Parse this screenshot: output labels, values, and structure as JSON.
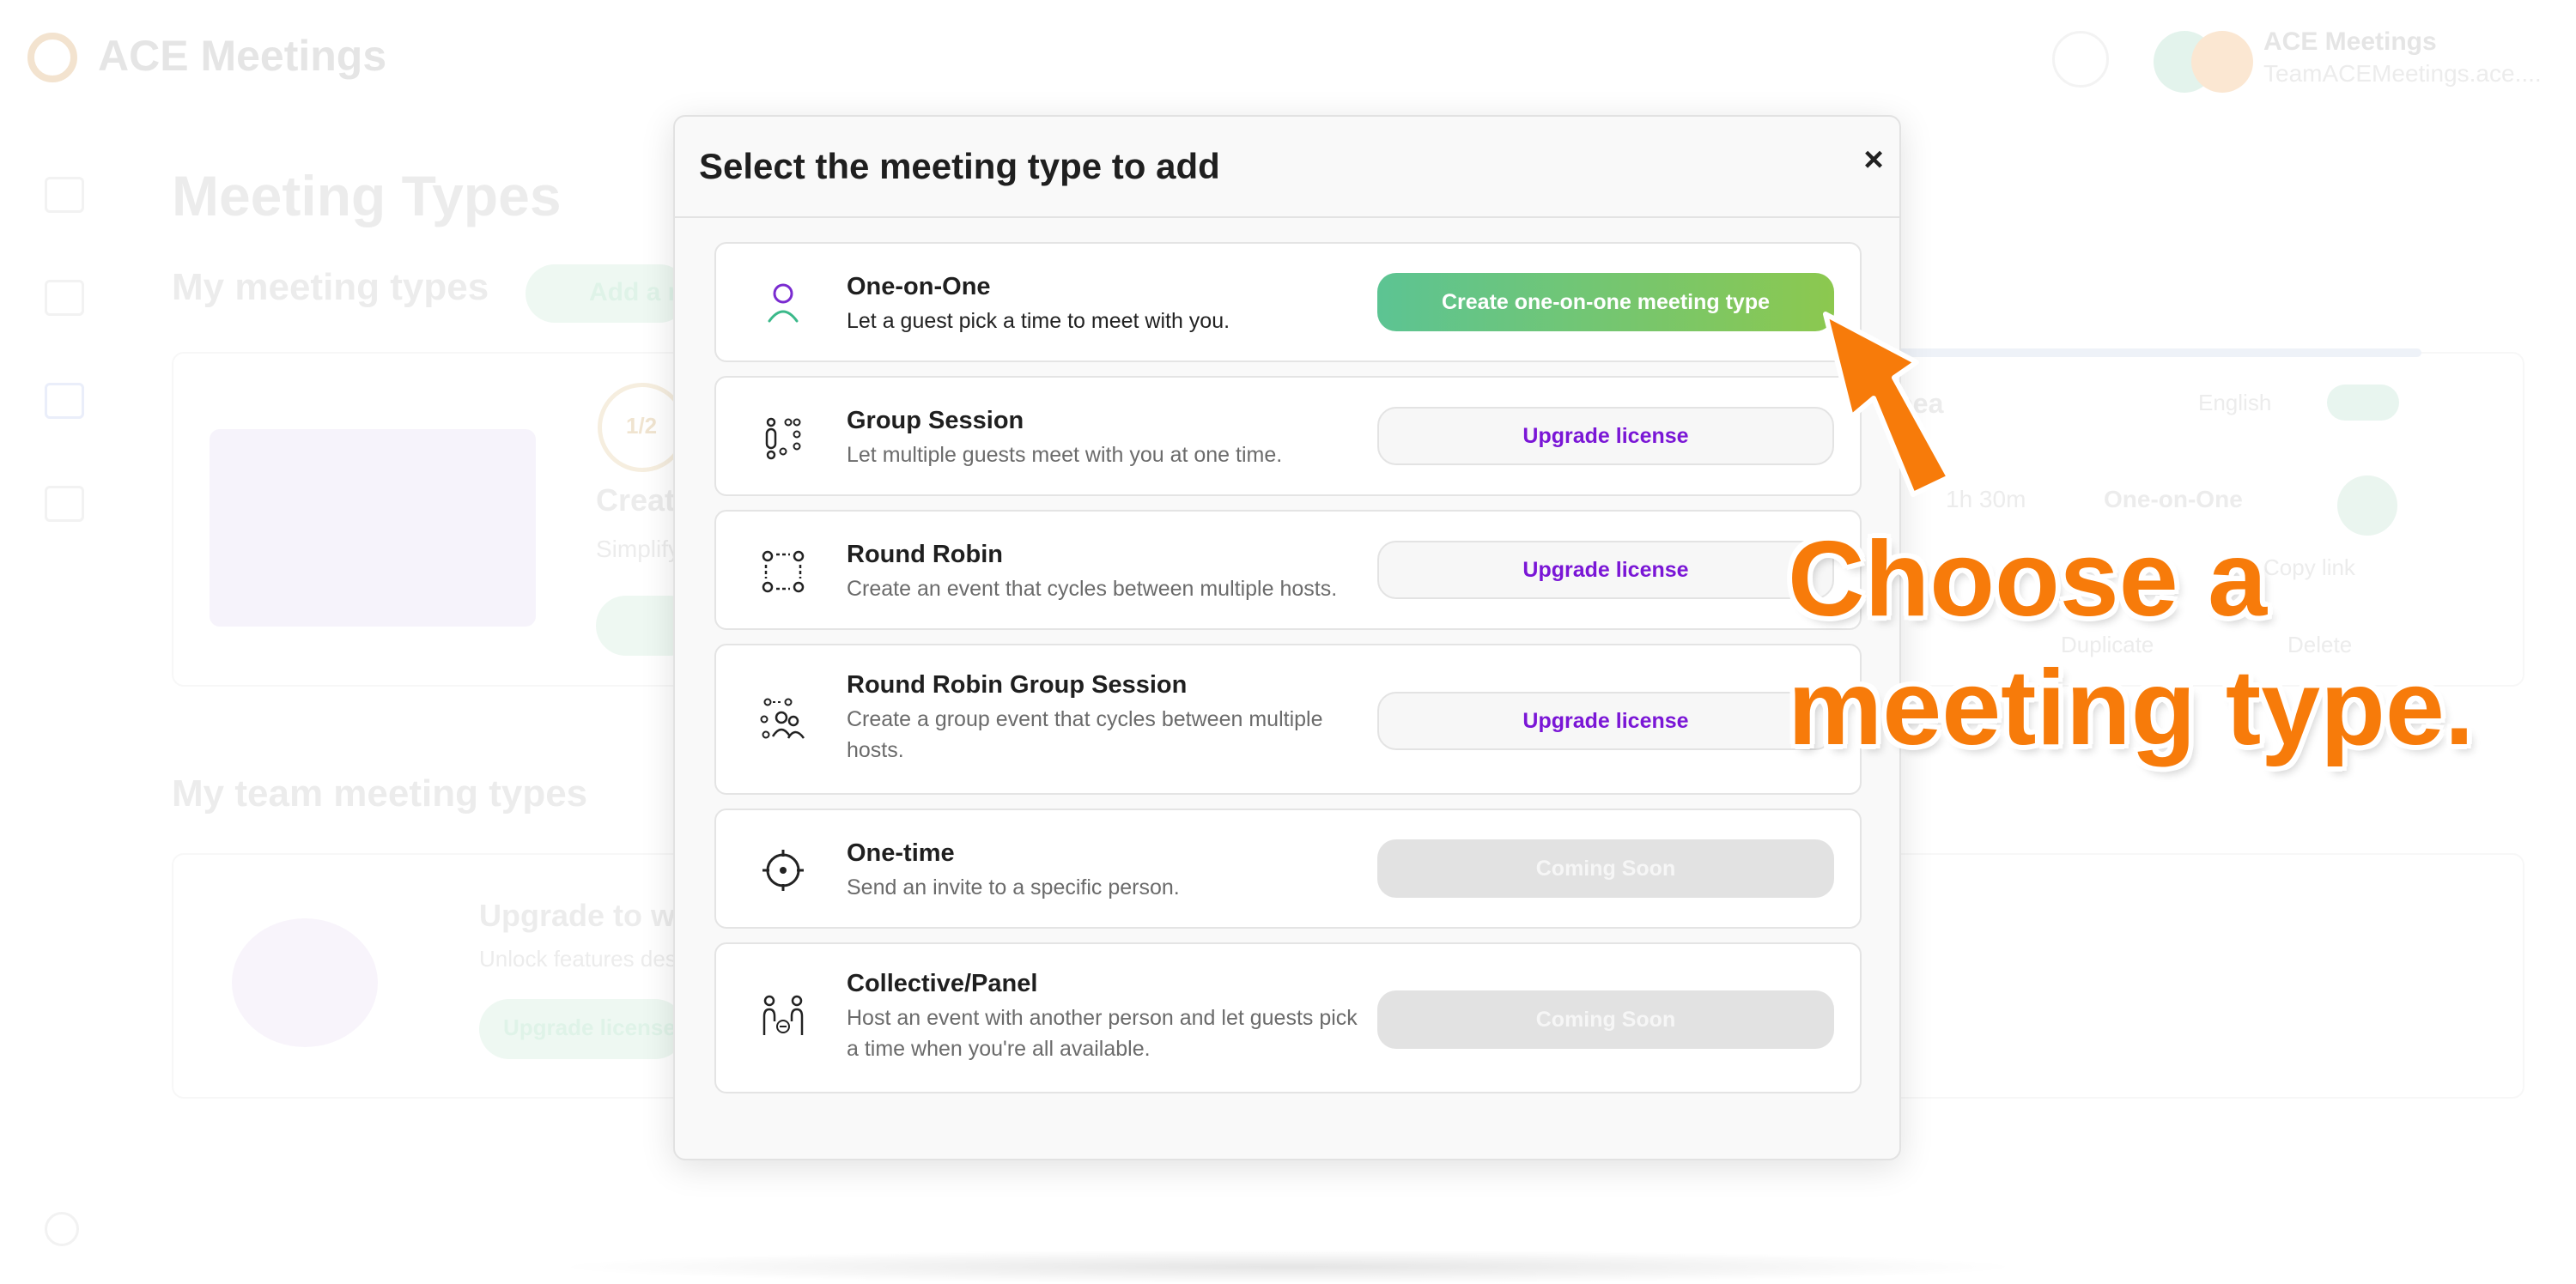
{
  "app": {
    "brand": "ACE Meetings",
    "account_name": "ACE Meetings",
    "account_email": "TeamACEMeetings.ace...."
  },
  "background": {
    "page_title": "Meeting Types",
    "my_meeting_types": "My meeting types",
    "add_button": "Add a n",
    "step": "1/2",
    "card_heading": "Creat",
    "card_text": "Simplify",
    "card_name": "eea",
    "language": "English",
    "duration": "1h 30m",
    "meeting_kind": "One-on-One",
    "copy_link": "Copy link",
    "duplicate": "Duplicate",
    "delete": "Delete",
    "team_meeting_types": "My team meeting types",
    "upgrade_heading": "Upgrade to wo",
    "upgrade_text": "Unlock features des",
    "upgrade_button": "Upgrade license"
  },
  "modal": {
    "title": "Select the meeting type to add",
    "close_label": "×",
    "options": [
      {
        "title": "One-on-One",
        "desc": "Let a guest pick a time to meet with you.",
        "button": "Create one-on-one meeting type",
        "icon": "person-icon"
      },
      {
        "title": "Group Session",
        "desc": "Let multiple guests meet with you at one time.",
        "button": "Upgrade license",
        "icon": "group-icon"
      },
      {
        "title": "Round Robin",
        "desc": "Create an event that cycles between multiple hosts.",
        "button": "Upgrade license",
        "icon": "round-robin-icon"
      },
      {
        "title": "Round Robin Group Session",
        "desc": "Create a group event that cycles between multiple hosts.",
        "button": "Upgrade license",
        "icon": "round-robin-group-icon"
      },
      {
        "title": "One-time",
        "desc": "Send an invite to a specific person.",
        "button": "Coming Soon",
        "icon": "target-icon"
      },
      {
        "title": "Collective/Panel",
        "desc": "Host an event with another person and let guests pick a time when you're all available.",
        "button": "Coming Soon",
        "icon": "collective-icon"
      }
    ]
  },
  "annotation": {
    "line1": "Choose a",
    "line2": "meeting type.",
    "color": "#f77b0a"
  },
  "colors": {
    "accent_purple": "#7a16d6",
    "create_gradient_start": "#5cc493",
    "create_gradient_end": "#8cc84f"
  }
}
